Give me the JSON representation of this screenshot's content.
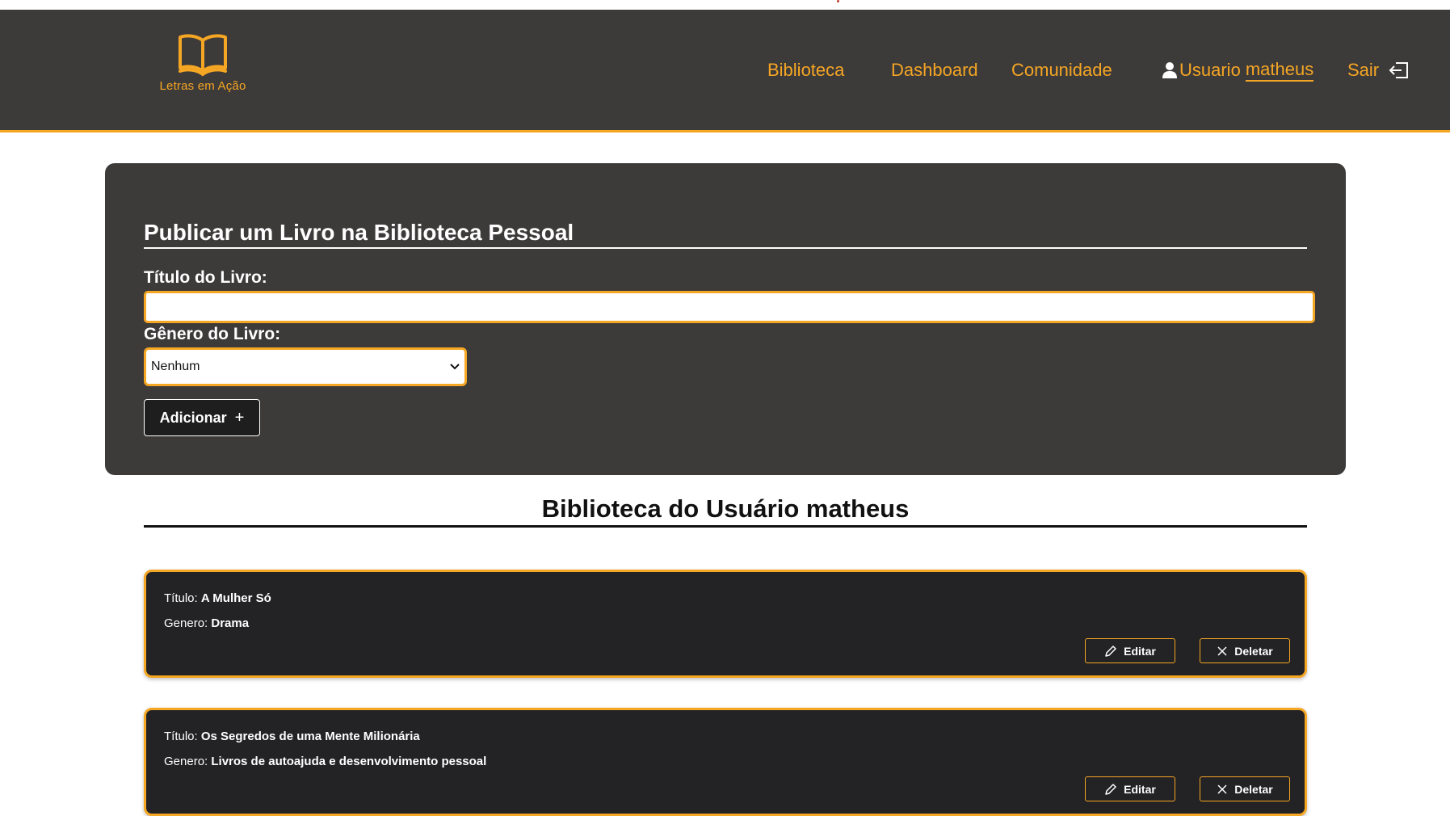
{
  "brand": {
    "name": "Letras em Ação",
    "accent": "#f5a623",
    "nav_bg": "#3d3a3a"
  },
  "nav": {
    "biblioteca": "Biblioteca",
    "dashboard": "Dashboard",
    "comunidade": "Comunidade",
    "user_prefix": "Usuario",
    "username": "matheus",
    "sair": "Sair"
  },
  "publish": {
    "title": "Publicar um Livro na Biblioteca Pessoal",
    "titulo_label": "Título do Livro:",
    "titulo_value": "",
    "genero_label": "Gênero do Livro:",
    "genero_selected": "Nenhum",
    "add_button": "Adicionar"
  },
  "library": {
    "title": "Biblioteca do Usuário matheus",
    "titulo_prefix": "Título:",
    "genero_prefix": "Genero:",
    "edit_label": "Editar",
    "delete_label": "Deletar",
    "books": [
      {
        "titulo": "A Mulher Só",
        "genero": "Drama"
      },
      {
        "titulo": "Os Segredos de uma Mente Milionária",
        "genero": "Livros de autoajuda e desenvolvimento pessoal"
      }
    ]
  }
}
